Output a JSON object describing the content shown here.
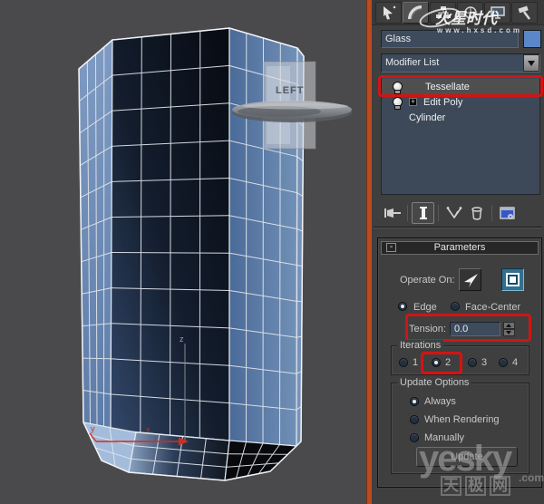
{
  "viewport": {
    "object_label": "LEFT",
    "axis": {
      "x": "x",
      "y": "y",
      "z": "z"
    }
  },
  "watermark_top": {
    "brand": "火星时代",
    "url": "www.hxsd.com"
  },
  "watermark_bottom": {
    "brand": "yesky",
    "suffix": ".com",
    "cn_chars": [
      "天",
      "极",
      "网"
    ]
  },
  "panel": {
    "tabs": [
      "create",
      "modify",
      "hierarchy",
      "motion",
      "display",
      "utilities"
    ],
    "object_name": "Glass",
    "modifier_list_label": "Modifier List",
    "stack": {
      "items": [
        {
          "label": "Tessellate"
        },
        {
          "label": "Edit Poly",
          "plus": "+"
        },
        {
          "label": "Cylinder"
        }
      ]
    },
    "stack_tools": [
      "pin-stack",
      "show-end-result",
      "make-unique",
      "remove-modifier",
      "configure-modifier-sets"
    ],
    "parameters": {
      "header": "Parameters",
      "collapse": "-",
      "operate_on_label": "Operate On:",
      "topology": [
        {
          "label": "Edge",
          "selected": true
        },
        {
          "label": "Face-Center",
          "selected": false
        }
      ],
      "tension_label": "Tension:",
      "tension_value": "0.0",
      "iterations": {
        "label": "Iterations",
        "options": [
          "1",
          "2",
          "3",
          "4"
        ],
        "selected": "2"
      },
      "update_options": {
        "label": "Update Options",
        "options": [
          "Always",
          "When Rendering",
          "Manually"
        ],
        "selected": "Always"
      },
      "update_button": "Update"
    }
  },
  "colors": {
    "annotation_red": "#d31414",
    "swatch_blue": "#5b87c9",
    "field_bg": "#3d4b5d",
    "stripe_orange": "#bb4a1f",
    "viewport_bg": "#4a4a4c"
  }
}
